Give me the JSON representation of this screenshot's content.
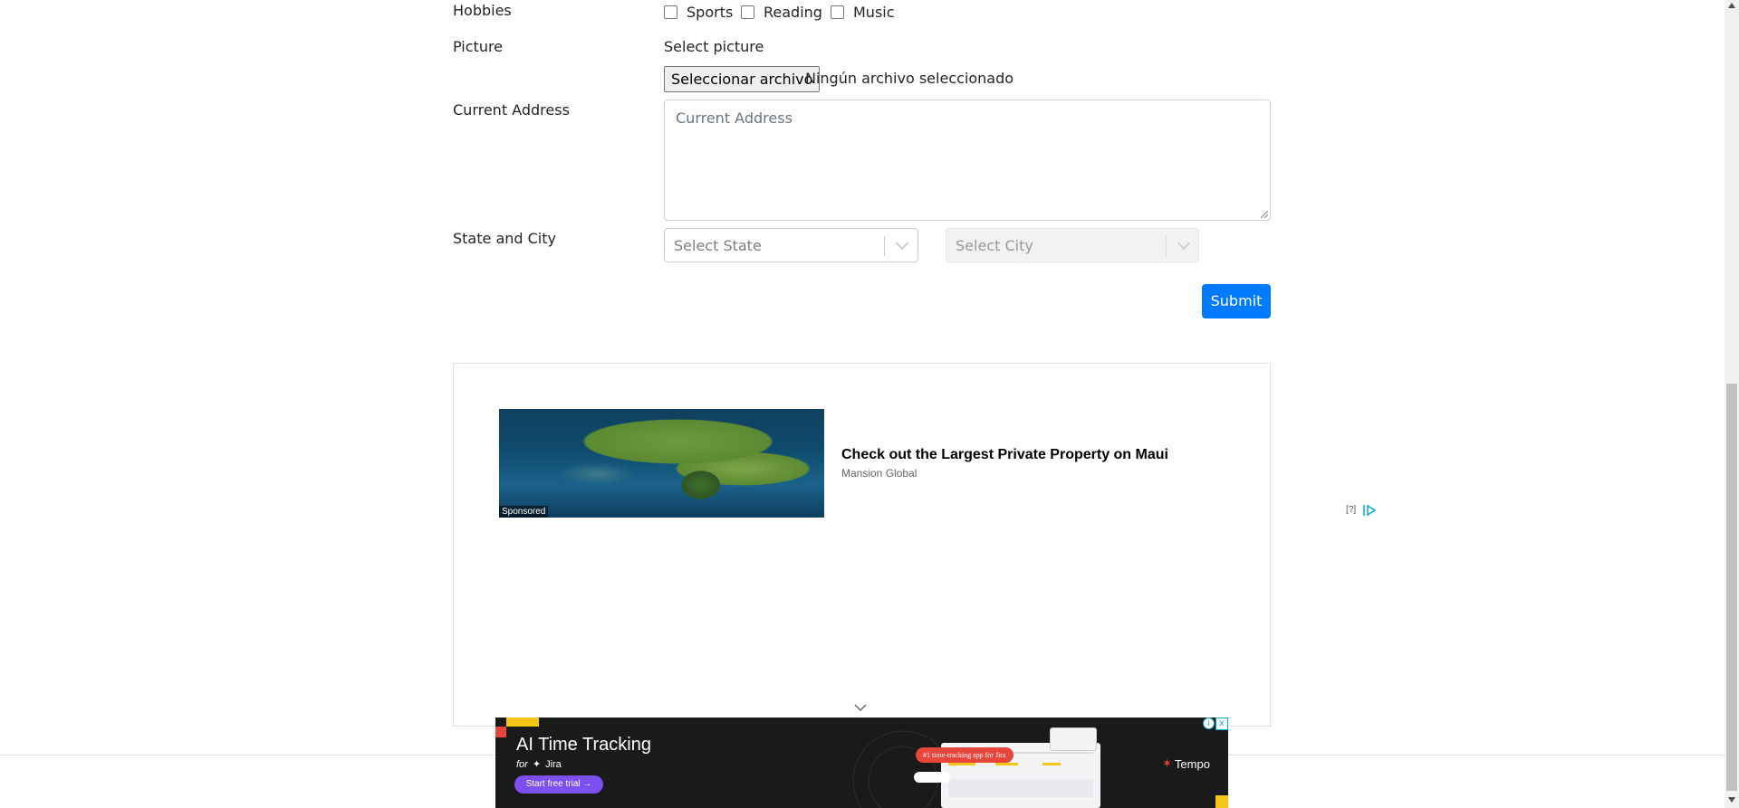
{
  "form": {
    "hobbies": {
      "label": "Hobbies",
      "options": [
        "Sports",
        "Reading",
        "Music"
      ]
    },
    "picture": {
      "label": "Picture",
      "sublabel": "Select picture",
      "button": "Seleccionar archivo",
      "status": "Ningún archivo seleccionado"
    },
    "address": {
      "label": "Current Address",
      "placeholder": "Current Address"
    },
    "state_city": {
      "label": "State and City",
      "state_placeholder": "Select State",
      "city_placeholder": "Select City"
    },
    "submit": "Submit"
  },
  "ad": {
    "title": "Check out the Largest Private Property on Maui",
    "source": "Mansion Global",
    "sponsored": "Sponsored",
    "help": "[?]"
  },
  "bottom_ad": {
    "headline": "AI Time Tracking",
    "for": "for",
    "product": "Jira",
    "cta": "Start free trial",
    "badge": "#1 time-tracking app for Jira",
    "brand": "Tempo",
    "info": "i",
    "close": "x"
  },
  "colors": {
    "primary": "#007bff",
    "ad_dark": "#1a1a1a",
    "cta_purple": "#7b4ff0",
    "badge_red": "#e8453c",
    "accent_yellow": "#f5c518"
  }
}
